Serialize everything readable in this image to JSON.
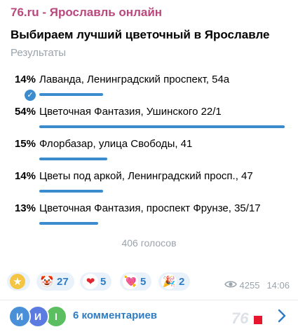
{
  "channel": "76.ru - Ярославль онлайн",
  "poll": {
    "title": "Выбираем лучший цветочный в Ярославле",
    "subtitle": "Результаты",
    "options": [
      {
        "percent": "14%",
        "text": "Лаванда, Ленинградский проспект, 54а",
        "value": 0.14,
        "chosen": true
      },
      {
        "percent": "54%",
        "text": "Цветочная Фантазия, Ушинского 22/1",
        "value": 0.54,
        "chosen": false
      },
      {
        "percent": "15%",
        "text": "Флорбазар, улица Свободы, 41",
        "value": 0.15,
        "chosen": false
      },
      {
        "percent": "14%",
        "text": "Цветы под аркой, Ленинградский просп., 47",
        "value": 0.14,
        "chosen": false
      },
      {
        "percent": "13%",
        "text": "Цветочная Фантазия, проспект Фрунзе, 35/17",
        "value": 0.13,
        "chosen": false
      }
    ],
    "votes": "406 голосов"
  },
  "reactions": [
    {
      "icon": "star-icon",
      "glyph": "★",
      "count": ""
    },
    {
      "icon": "clown-icon",
      "glyph": "🤡",
      "count": "27"
    },
    {
      "icon": "heart-icon",
      "glyph": "❤",
      "count": "5"
    },
    {
      "icon": "heart-arrow-icon",
      "glyph": "💘",
      "count": "5"
    },
    {
      "icon": "party-popper-icon",
      "glyph": "🎉",
      "count": "2"
    }
  ],
  "meta": {
    "views": "4255",
    "time": "14:06"
  },
  "footer": {
    "avatars": [
      {
        "letter": "И",
        "color": "#4a90d9"
      },
      {
        "letter": "И",
        "color": "#5b7be0"
      },
      {
        "letter": "I",
        "color": "#5bbf62"
      }
    ],
    "comments": "6 комментариев",
    "logo": "76"
  },
  "colors": {
    "accent": "#3a8ccf",
    "channel": "#b9487d",
    "muted": "#9aa3ab"
  }
}
